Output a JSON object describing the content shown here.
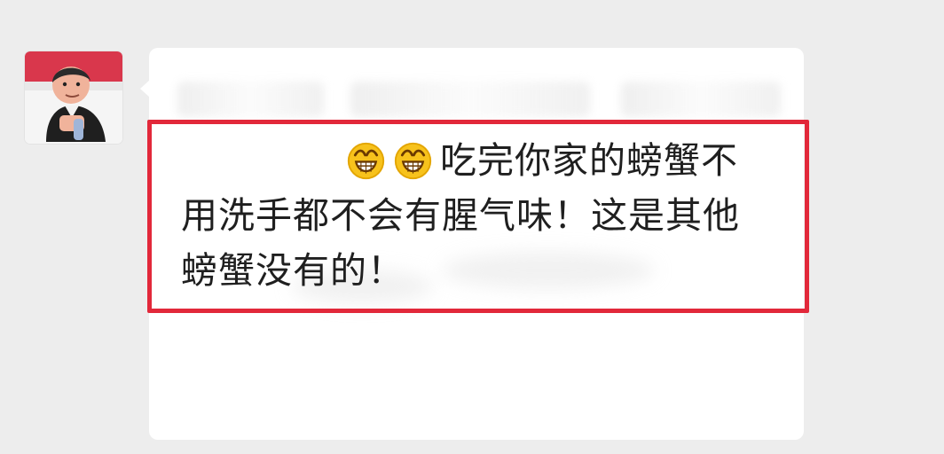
{
  "screen": {
    "background": "#ededed"
  },
  "avatar": {
    "icon": "person-portrait"
  },
  "message": {
    "emoji": [
      "grinning-face-icon",
      "grinning-face-icon"
    ],
    "line_1": "吃完你家的螃蟹不",
    "line_2": "用洗手都不会有腥气味！这是其他",
    "line_3": "螃蟹没有的！",
    "highlight_color": "#e2283a"
  }
}
